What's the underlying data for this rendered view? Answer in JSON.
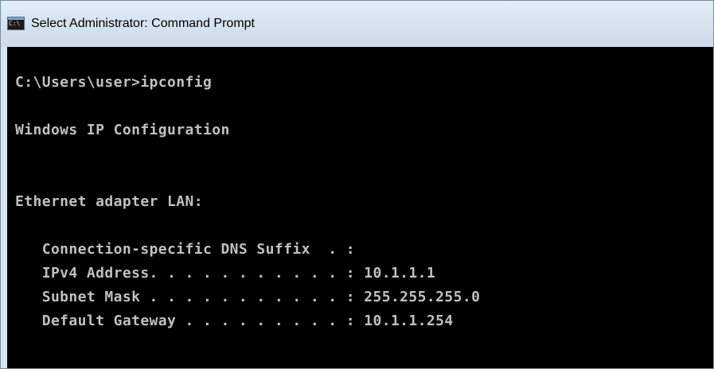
{
  "window": {
    "title": "Select Administrator: Command Prompt",
    "icon": "cmd-icon",
    "icon_label": "C:\\"
  },
  "console": {
    "lines": [
      "",
      "C:\\Users\\user>ipconfig",
      "",
      "Windows IP Configuration",
      "",
      "",
      "Ethernet adapter LAN:",
      "",
      "   Connection-specific DNS Suffix  . :",
      "   IPv4 Address. . . . . . . . . . . : 10.1.1.1",
      "   Subnet Mask . . . . . . . . . . . : 255.255.255.0",
      "   Default Gateway . . . . . . . . . : 10.1.1.254"
    ]
  },
  "colors": {
    "console_background": "#000000",
    "console_text": "#c0c0c0",
    "titlebar": "#d6e3f0"
  }
}
